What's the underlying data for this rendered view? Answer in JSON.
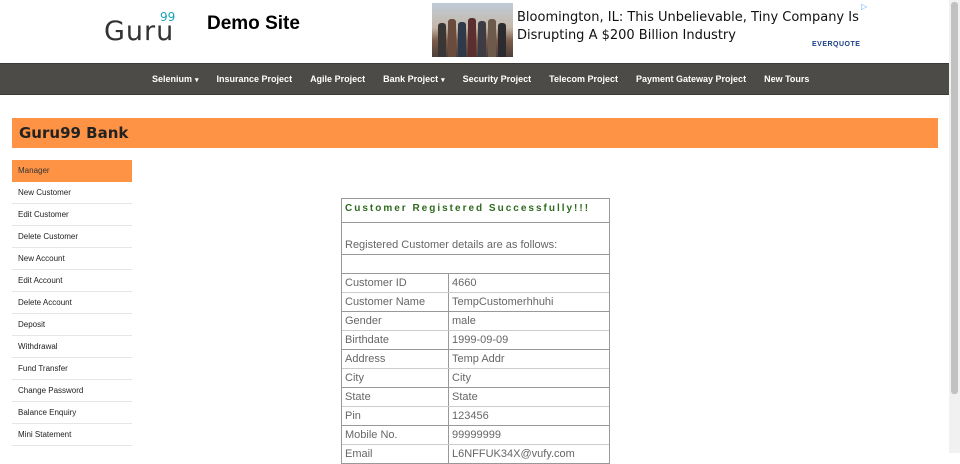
{
  "header": {
    "logo_text": "Guru",
    "logo_superscript": "99",
    "site_title": "Demo Site"
  },
  "ad": {
    "headline": "Bloomington, IL: This Unbelievable, Tiny Company Is Disrupting A $200 Billion Industry",
    "brand": "EVERQUOTE"
  },
  "nav": {
    "items": [
      {
        "label": "Selenium",
        "dropdown": true
      },
      {
        "label": "Insurance Project",
        "dropdown": false
      },
      {
        "label": "Agile Project",
        "dropdown": false
      },
      {
        "label": "Bank Project",
        "dropdown": true
      },
      {
        "label": "Security Project",
        "dropdown": false
      },
      {
        "label": "Telecom Project",
        "dropdown": false
      },
      {
        "label": "Payment Gateway Project",
        "dropdown": false
      },
      {
        "label": "New Tours",
        "dropdown": false
      }
    ]
  },
  "bank": {
    "title": "Guru99 Bank"
  },
  "sidebar": {
    "items": [
      {
        "label": "Manager"
      },
      {
        "label": "New Customer"
      },
      {
        "label": "Edit Customer"
      },
      {
        "label": "Delete Customer"
      },
      {
        "label": "New Account"
      },
      {
        "label": "Edit Account"
      },
      {
        "label": "Delete Account"
      },
      {
        "label": "Deposit"
      },
      {
        "label": "Withdrawal"
      },
      {
        "label": "Fund Transfer"
      },
      {
        "label": "Change Password"
      },
      {
        "label": "Balance Enquiry"
      },
      {
        "label": "Mini Statement"
      }
    ]
  },
  "result": {
    "heading": "Customer Registered Successfully!!!",
    "subheading": "Registered Customer details are as follows:",
    "rows": [
      {
        "key": "Customer ID",
        "value": "4660"
      },
      {
        "key": "Customer Name",
        "value": "TempCustomerhhuhi"
      },
      {
        "key": "Gender",
        "value": "male"
      },
      {
        "key": "Birthdate",
        "value": "1999-09-09"
      },
      {
        "key": "Address",
        "value": "Temp Addr"
      },
      {
        "key": "City",
        "value": "City"
      },
      {
        "key": "State",
        "value": "State"
      },
      {
        "key": "Pin",
        "value": "123456"
      },
      {
        "key": "Mobile No.",
        "value": "99999999"
      },
      {
        "key": "Email",
        "value": "L6NFFUK34X@vufy.com"
      }
    ]
  },
  "colors": {
    "accent": "#ff9345",
    "nav_bg": "#4d4b47",
    "success_text": "#2e6b1f"
  }
}
